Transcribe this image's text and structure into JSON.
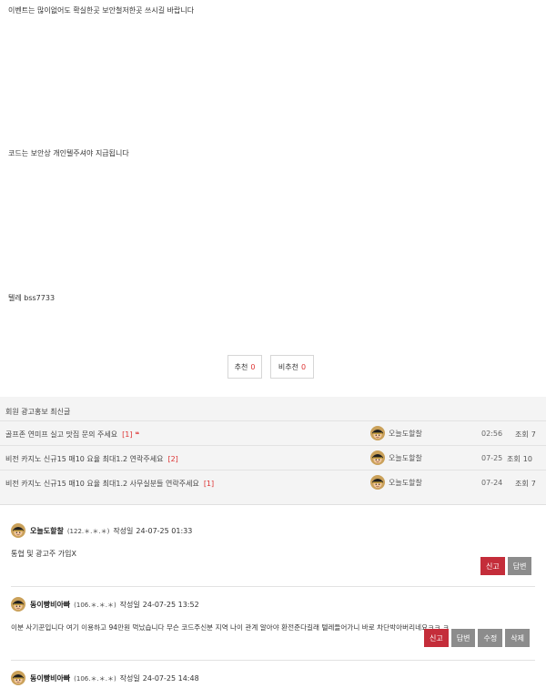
{
  "post": {
    "lines": [
      "이벤트는 많이없어도 확실한곳 보안철저한곳 쓰시길 바랍니다",
      "코드는 보안상 개인텔주셔야 지급됩니다",
      "텔레 bss7733"
    ]
  },
  "vote": {
    "up_label": "추천",
    "up_count": "0",
    "down_label": "비추천",
    "down_count": "0"
  },
  "related": {
    "title": "회원 광고홍보 최신글",
    "rows": [
      {
        "subject": "골프존 연미프 실고 맛집 문의 주세요",
        "comments": "[1]",
        "quote": "❝",
        "nick": "오늘도할찰",
        "date": "02:56",
        "views_label": "조회",
        "views": "7"
      },
      {
        "subject": "비전 카지노 신규15 매10 요율 최대1.2 연락주세요",
        "comments": "[2]",
        "quote": "",
        "nick": "오늘도할찰",
        "date": "07-25",
        "views_label": "조회",
        "views": "10"
      },
      {
        "subject": "비전 카지노 신규15 매10 요율 최대1.2 사무실분들 연락주세요",
        "comments": "[1]",
        "quote": "",
        "nick": "오늘도할찰",
        "date": "07-24",
        "views_label": "조회",
        "views": "7"
      }
    ]
  },
  "comments": [
    {
      "nick": "오늘도할찰",
      "ip": "(122.＊.＊.＊)",
      "written_label": "작성일",
      "date": "24-07-25 01:33",
      "text": "통협 및 광고주 가입X",
      "buttons": [
        "신고",
        "답변"
      ]
    },
    {
      "nick": "동이빵비아빠",
      "ip": "(106.＊.＊.＊)",
      "written_label": "작성일",
      "date": "24-07-25 13:52",
      "text": "이분 사기꾼입니다 여기 이용하고 94만원 먹났습니다 무슨 코드주신분 지역 나이 관계 알아야 환전준다길래 텔레들어가니 바로 차단박아버리네요ㅋㅋ ㅋ",
      "buttons": [
        "신고",
        "답변",
        "수정",
        "삭제"
      ]
    },
    {
      "nick": "동이빵비아빠",
      "ip": "(106.＊.＊.＊)",
      "written_label": "작성일",
      "date": "24-07-25 14:48",
      "text": "",
      "buttons": []
    }
  ],
  "colors": {
    "accent_red": "#c42d3a",
    "button_gray": "#8c8c8c",
    "count_red": "#dd3333"
  },
  "icons": {
    "avatar": "pilot-avatar-icon"
  }
}
